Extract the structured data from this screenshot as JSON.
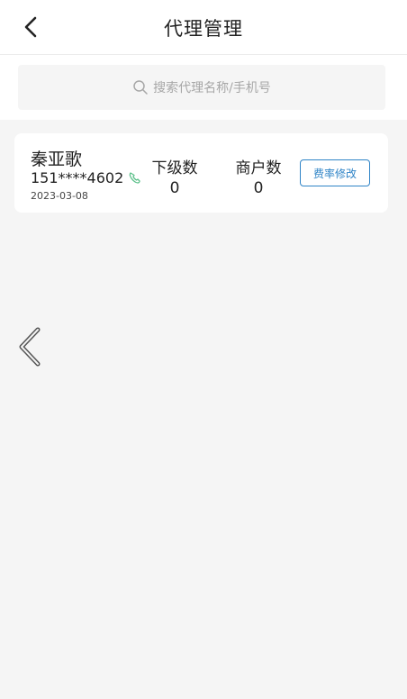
{
  "header": {
    "title": "代理管理",
    "back_icon": "chevron-left-icon"
  },
  "search": {
    "placeholder": "搜索代理名称/手机号",
    "icon": "search-icon"
  },
  "agents": [
    {
      "name": "秦亚歌",
      "phone": "151****4602",
      "date": "2023-03-08",
      "sub_label": "下级数",
      "sub_value": "0",
      "merchant_label": "商户数",
      "merchant_value": "0",
      "rate_button": "费率修改"
    }
  ],
  "colors": {
    "accent": "#2f84c7",
    "phone_icon": "#5cc08a",
    "background": "#f5f5f5"
  }
}
